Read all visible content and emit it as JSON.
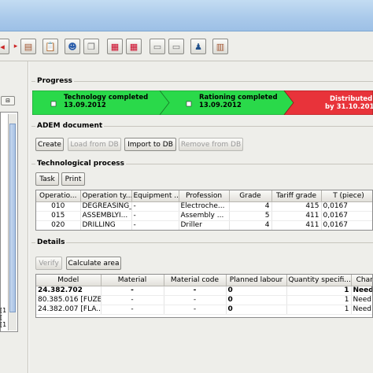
{
  "progress": {
    "section_title": "Progress",
    "stages": [
      {
        "label": "Technology completed",
        "date": "13.09.2012",
        "color": "#2ad94a"
      },
      {
        "label": "Rationing completed",
        "date": "13.09.2012",
        "color": "#2ad94a"
      },
      {
        "label": "Distributed",
        "date": "by 31.10.2012",
        "color": "#e8333a"
      }
    ]
  },
  "adem": {
    "section_title": "ADEM document",
    "buttons": {
      "create": "Create",
      "load": "Load from DB",
      "import": "Import to DB",
      "remove": "Remove from DB"
    }
  },
  "tech": {
    "section_title": "Technological process",
    "buttons": {
      "task": "Task",
      "print": "Print"
    },
    "columns": [
      "Operatio...",
      "Operation ty...",
      "Equipment ...",
      "Profession",
      "Grade",
      "Tariff grade",
      "T (piece)"
    ],
    "rows": [
      [
        "010",
        "DEGREASING_...",
        "-",
        "Electroche...",
        "4",
        "415",
        "0,0167"
      ],
      [
        "015",
        "ASSEMBLYI...",
        "-",
        "Assembly ...",
        "5",
        "411",
        "0,0167"
      ],
      [
        "020",
        "DRILLING",
        "-",
        "Driller",
        "4",
        "411",
        "0,0167"
      ]
    ]
  },
  "details": {
    "section_title": "Details",
    "buttons": {
      "verify": "Verify",
      "calc": "Calculate area"
    },
    "columns": [
      "Model",
      "Material",
      "Material code",
      "Planned labour",
      "Quantity specifi...",
      "Chara"
    ],
    "rows": [
      [
        "24.382.702",
        "-",
        "-",
        "0",
        "1",
        "Need va"
      ],
      [
        "80.385.016 [FUZE]",
        "-",
        "-",
        "0",
        "1",
        "Need va"
      ],
      [
        "24.382.007 [FLA...",
        "-",
        "-",
        "0",
        "1",
        "Need va"
      ]
    ]
  },
  "left": {
    "marks": [
      "[1",
      "[",
      "[1",
      "[1"
    ]
  },
  "toolbar_icons": [
    "arrow-back-icon",
    "arrow-fwd-icon",
    "film-icon",
    "clipboard-icon",
    "user-icon",
    "copy-icon",
    "calendar-icon",
    "calendar-alt-icon",
    "card-icon",
    "card-alt-icon",
    "person-icon",
    "book-icon"
  ]
}
